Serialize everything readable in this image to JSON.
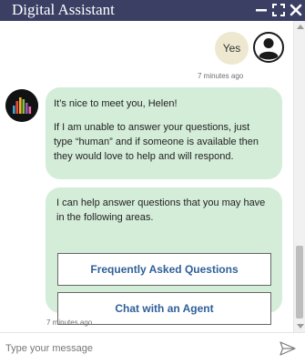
{
  "window": {
    "title": "Digital Assistant",
    "controls": [
      "minimize-icon",
      "maximize-icon",
      "close-icon"
    ]
  },
  "messages": [
    {
      "from": "user",
      "text": "Yes",
      "time": "7 minutes ago"
    },
    {
      "from": "bot",
      "paragraphs": [
        "It’s nice to meet you, Helen!",
        "If I am unable to answer your questions, just type “human” and if someone is available then they would love to help and will respond."
      ]
    },
    {
      "from": "bot",
      "text": "I can help answer questions that you may have in the following areas.",
      "options": [
        "Frequently Asked Questions",
        "Chat with an Agent"
      ],
      "time": "7 minutes ago"
    }
  ],
  "composer": {
    "placeholder": "Type your message",
    "send_icon": "send-icon"
  },
  "colors": {
    "titlebar": "#3a3f63",
    "bot_bubble": "#d4edd9",
    "user_bubble": "#efe8d0",
    "option_text": "#2f5f99"
  }
}
